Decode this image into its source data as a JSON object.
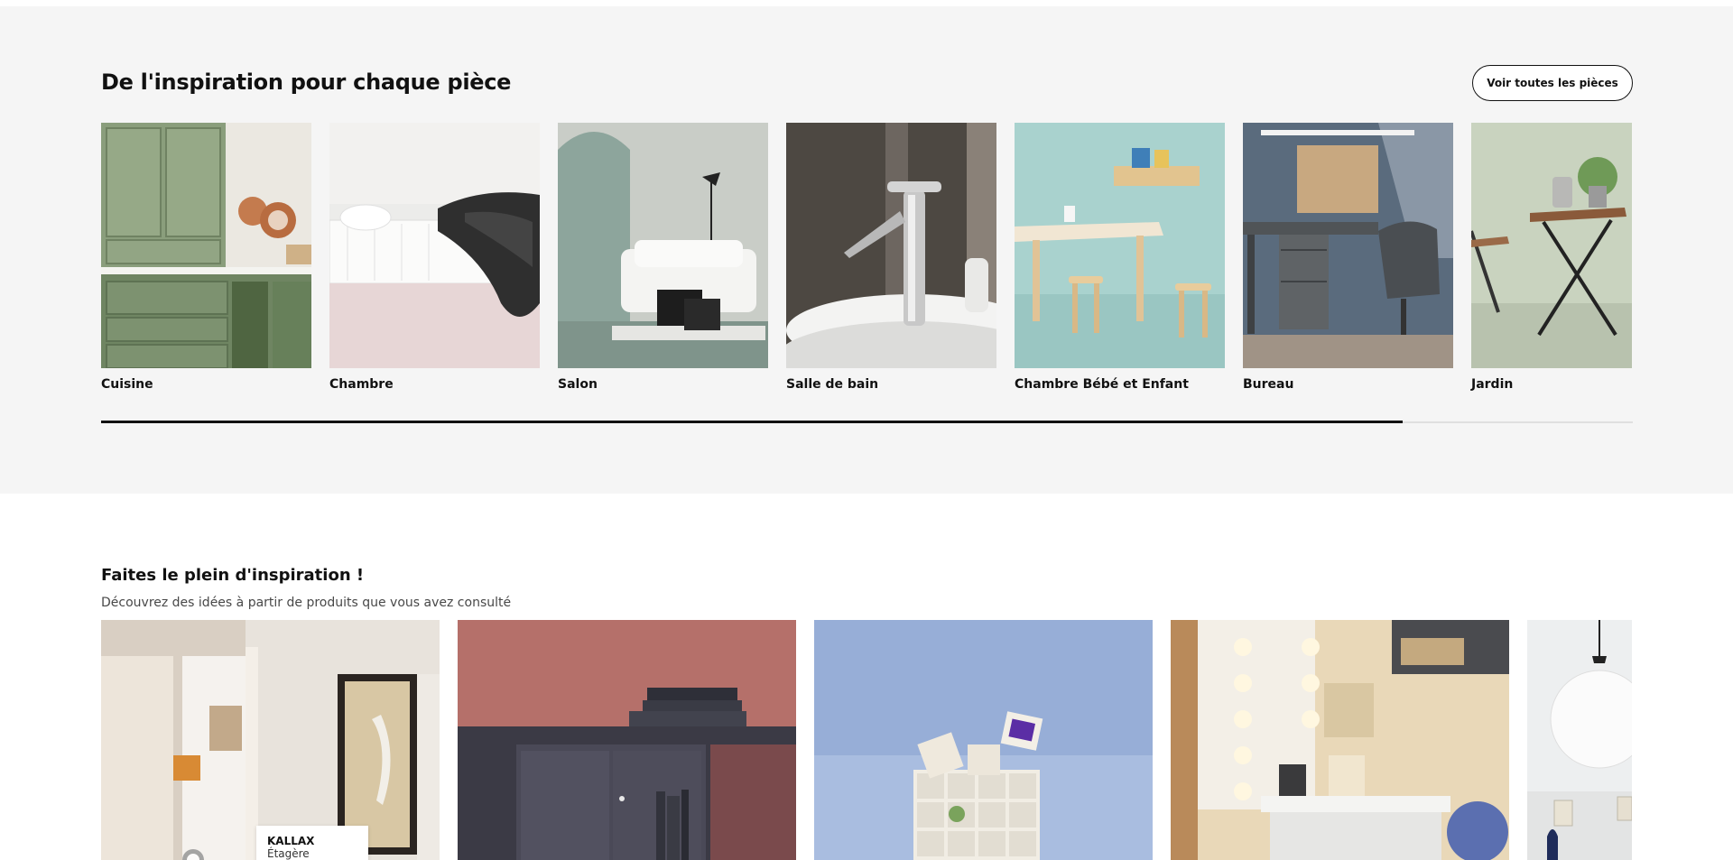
{
  "rooms_section": {
    "title": "De l'inspiration pour chaque pièce",
    "see_all_label": "Voir toutes les pièces",
    "rooms": [
      {
        "label": "Cuisine"
      },
      {
        "label": "Chambre"
      },
      {
        "label": "Salon"
      },
      {
        "label": "Salle de bain"
      },
      {
        "label": "Chambre Bébé et Enfant"
      },
      {
        "label": "Bureau"
      },
      {
        "label": "Jardin"
      }
    ],
    "scroll_progress": 0.85
  },
  "inspiration_section": {
    "title": "Faites le plein d'inspiration !",
    "subtitle": "Découvrez des idées à partir de produits que vous avez consulté",
    "product_tag": {
      "name": "KALLAX",
      "description": "Étagère"
    }
  },
  "colors": {
    "section_bg": "#f5f5f5",
    "text": "#111111",
    "accent": "#111111"
  }
}
